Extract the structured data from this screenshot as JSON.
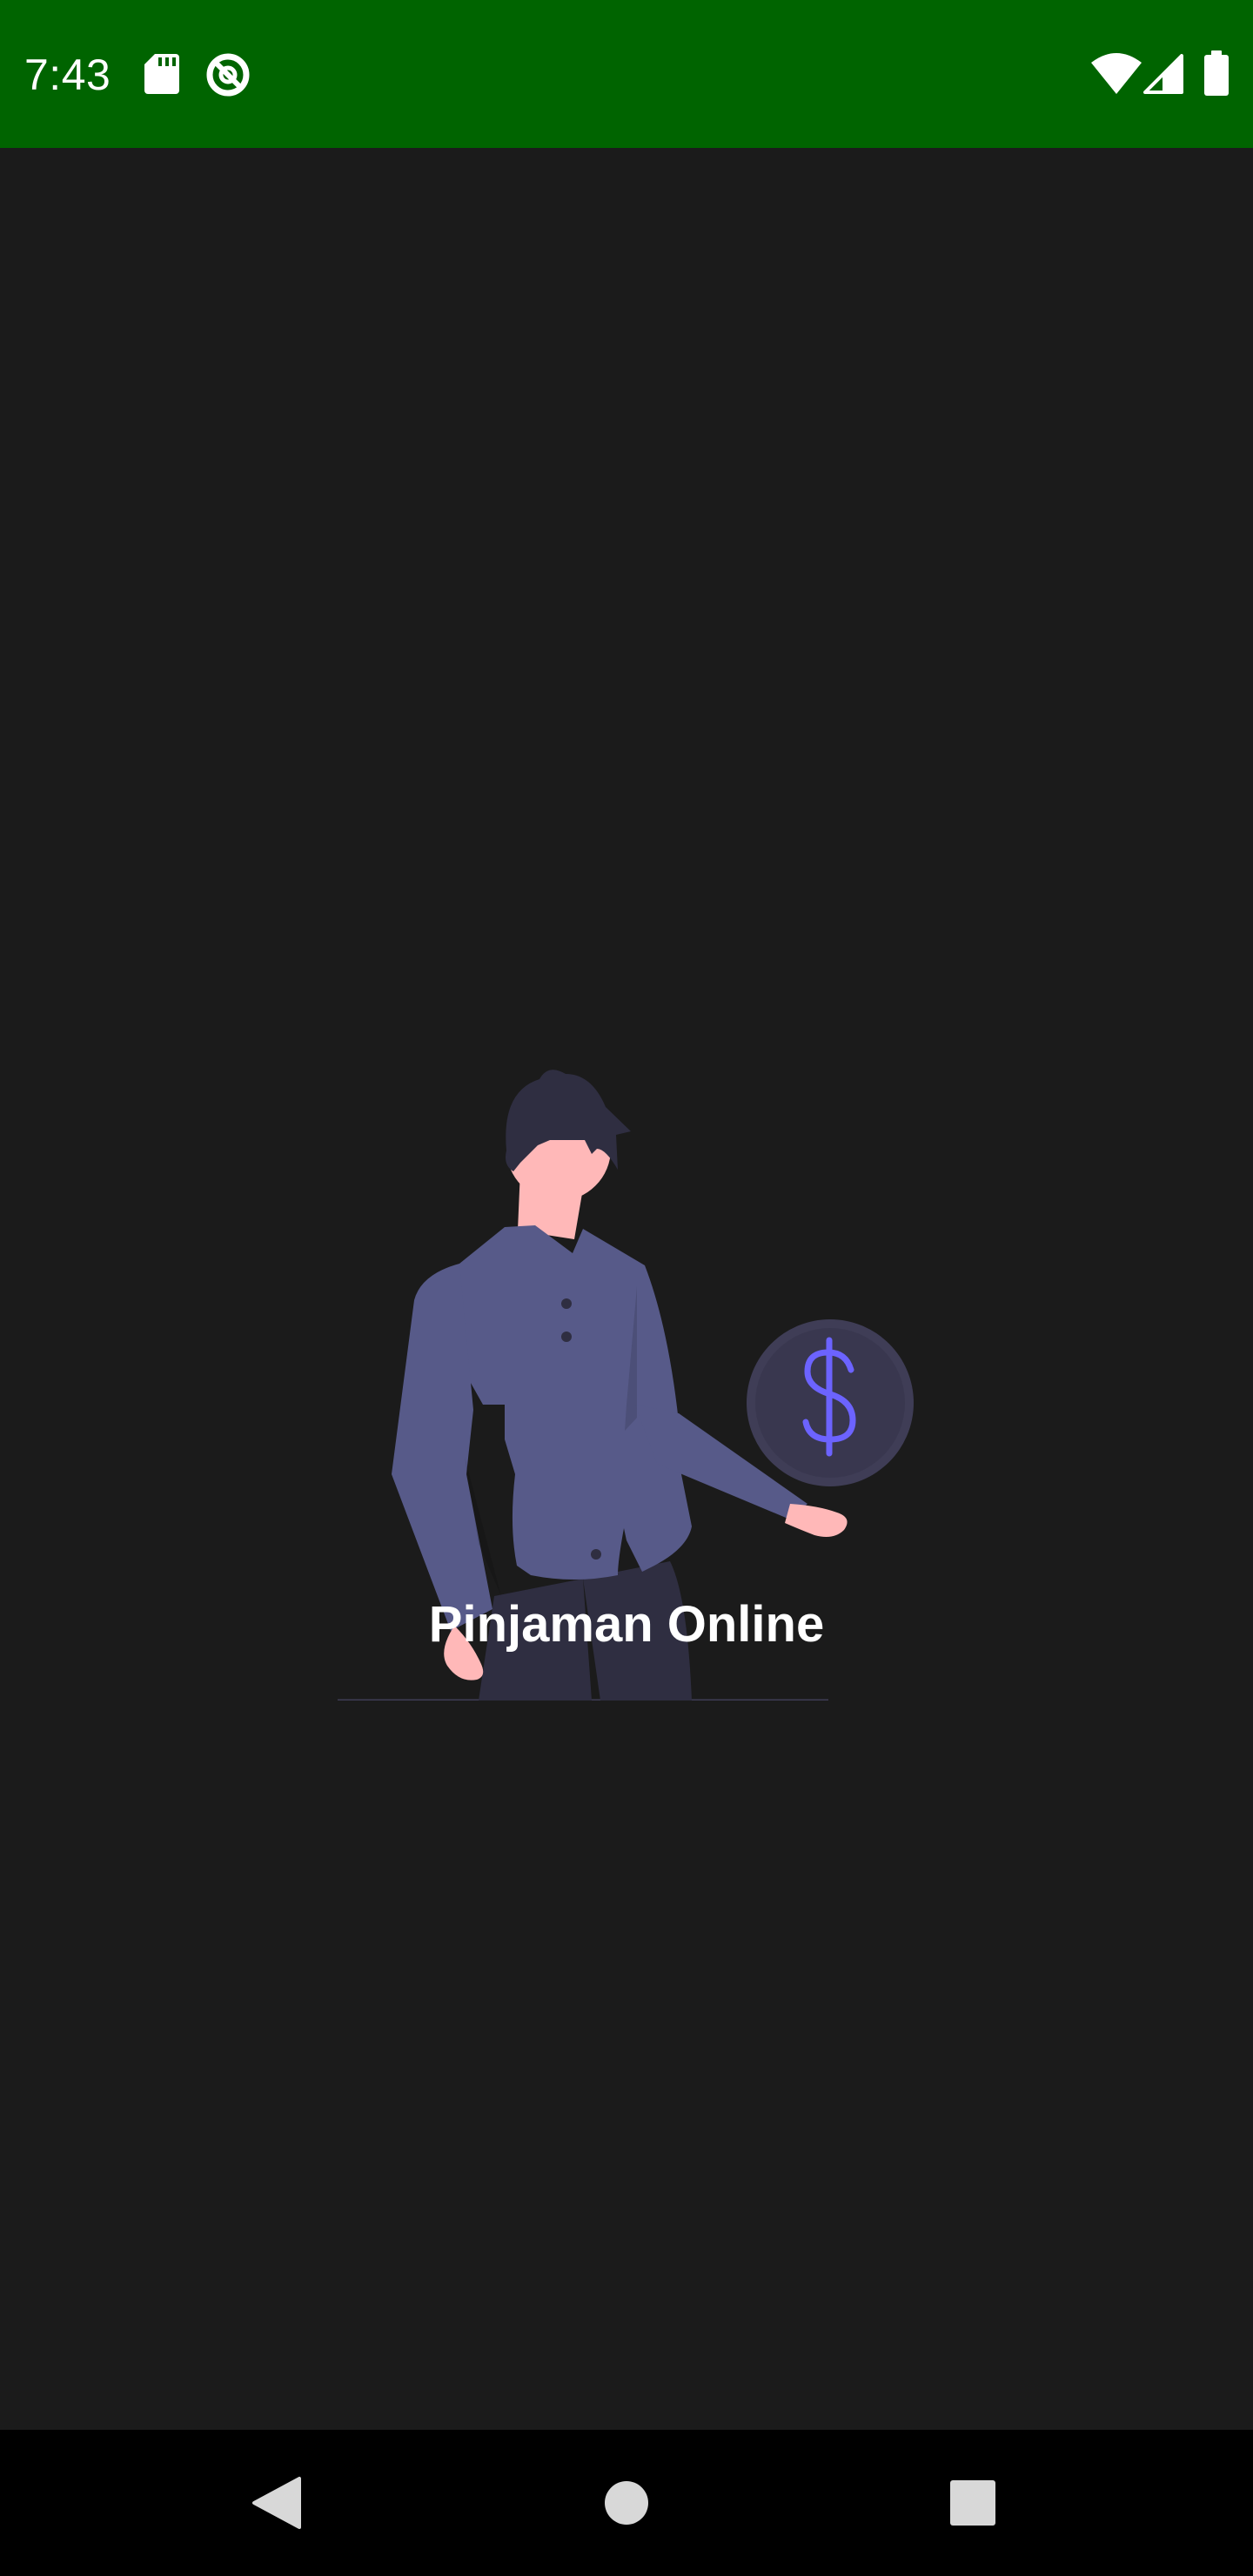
{
  "status_bar": {
    "time": "7:43",
    "background_color": "#006400",
    "left_icons": [
      "sd-card-icon",
      "data-saver-icon"
    ],
    "right_icons": [
      "wifi-icon",
      "cell-signal-icon",
      "battery-icon"
    ]
  },
  "splash": {
    "title": "Pinjaman Online",
    "background_color": "#1b1b1b",
    "illustration": "person-with-dollar-coin-illustration",
    "accent_color": "#6c63ff"
  },
  "nav_bar": {
    "buttons": [
      "back",
      "home",
      "recents"
    ]
  }
}
